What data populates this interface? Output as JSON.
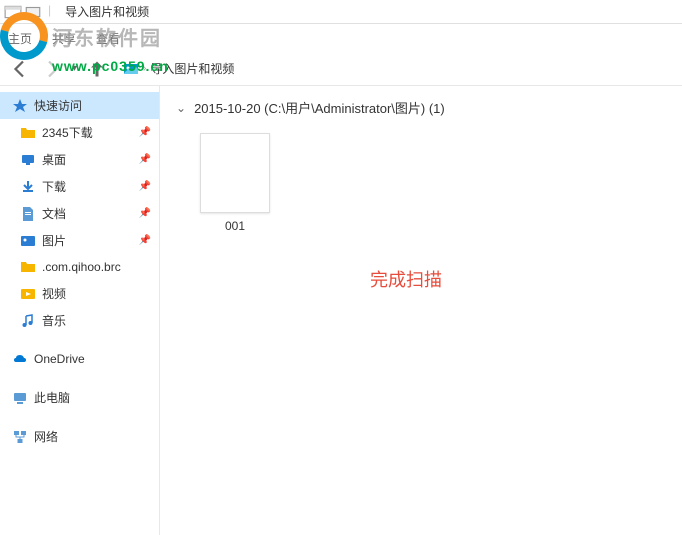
{
  "titlebar": {
    "title": "导入图片和视频"
  },
  "ribbon": {
    "tabs": [
      "主页",
      "共享",
      "查看"
    ]
  },
  "watermark": {
    "brand": "河东软件园",
    "url": "www.pc0359.cn"
  },
  "nav": {
    "breadcrumb_item": "导入图片和视频"
  },
  "sidebar": {
    "quickaccess": "快速访问",
    "items": [
      {
        "label": "2345下载",
        "pinned": true,
        "icon": "folder"
      },
      {
        "label": "桌面",
        "pinned": true,
        "icon": "desktop"
      },
      {
        "label": "下载",
        "pinned": true,
        "icon": "download"
      },
      {
        "label": "文档",
        "pinned": true,
        "icon": "doc"
      },
      {
        "label": "图片",
        "pinned": true,
        "icon": "pic"
      },
      {
        "label": ".com.qihoo.brc",
        "pinned": false,
        "icon": "folder"
      },
      {
        "label": "视频",
        "pinned": false,
        "icon": "video"
      },
      {
        "label": "音乐",
        "pinned": false,
        "icon": "music"
      }
    ],
    "onedrive": "OneDrive",
    "thispc": "此电脑",
    "network": "网络"
  },
  "main": {
    "folder_title": "2015-10-20 (C:\\用户\\Administrator\\图片) (1)",
    "files": [
      {
        "name": "001"
      }
    ],
    "status": "完成扫描"
  }
}
